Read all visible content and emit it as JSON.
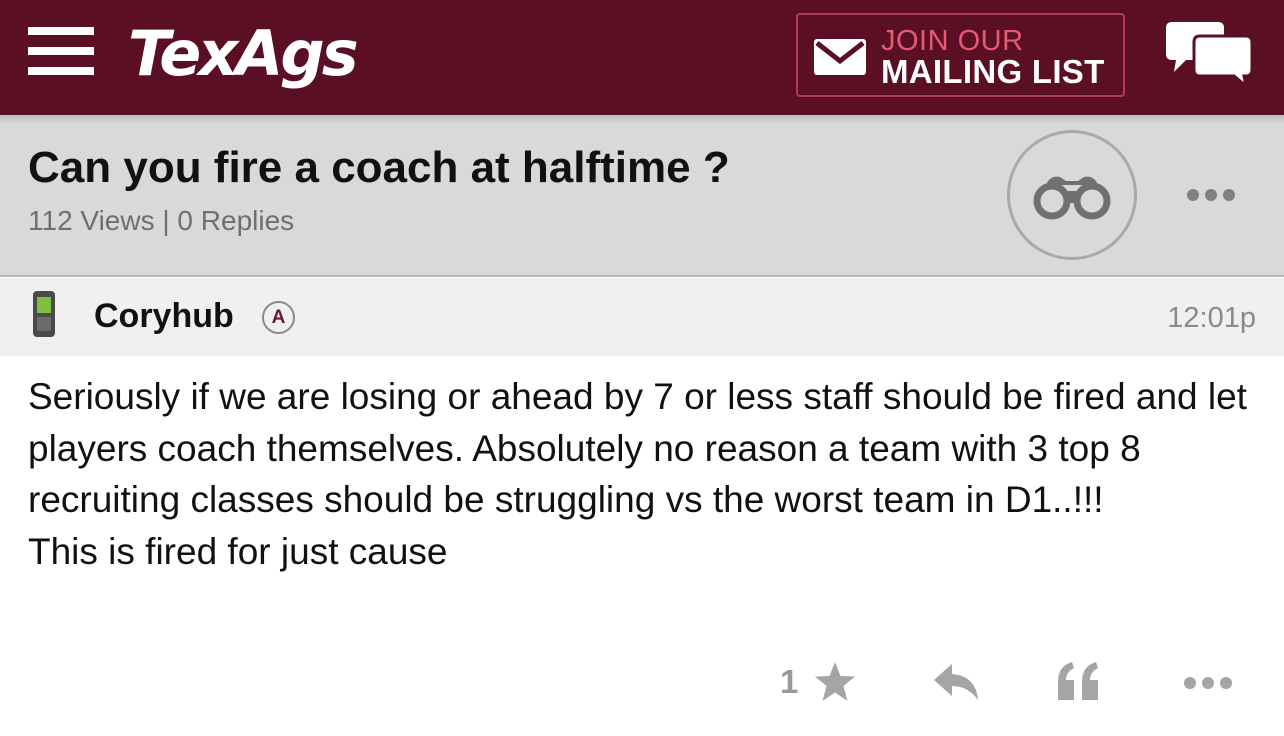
{
  "header": {
    "logo_text": "TexAgs",
    "mailing_line1": "JOIN OUR",
    "mailing_line2": "MAILING LIST",
    "brand_color": "#5b0f25",
    "icons": [
      "menu-icon",
      "mail-icon",
      "chat-icon"
    ]
  },
  "thread": {
    "title": "Can you fire a coach at halftime ?",
    "stats": "112 Views | 0 Replies",
    "icons": [
      "binoculars-icon",
      "more-icon"
    ]
  },
  "post": {
    "username": "Coryhub",
    "badge": "A",
    "time": "12:01p",
    "body": "Seriously if we are losing or ahead by 7 or less staff should be fired and let players coach themselves. Absolutely no reason a team with 3 top 8 recruiting classes should be struggling vs the worst team in D1..!!!\nThis is fired for just cause",
    "like_count": "1",
    "icons": [
      "phone-icon",
      "star-icon",
      "reply-icon",
      "quote-icon",
      "more-icon"
    ]
  }
}
